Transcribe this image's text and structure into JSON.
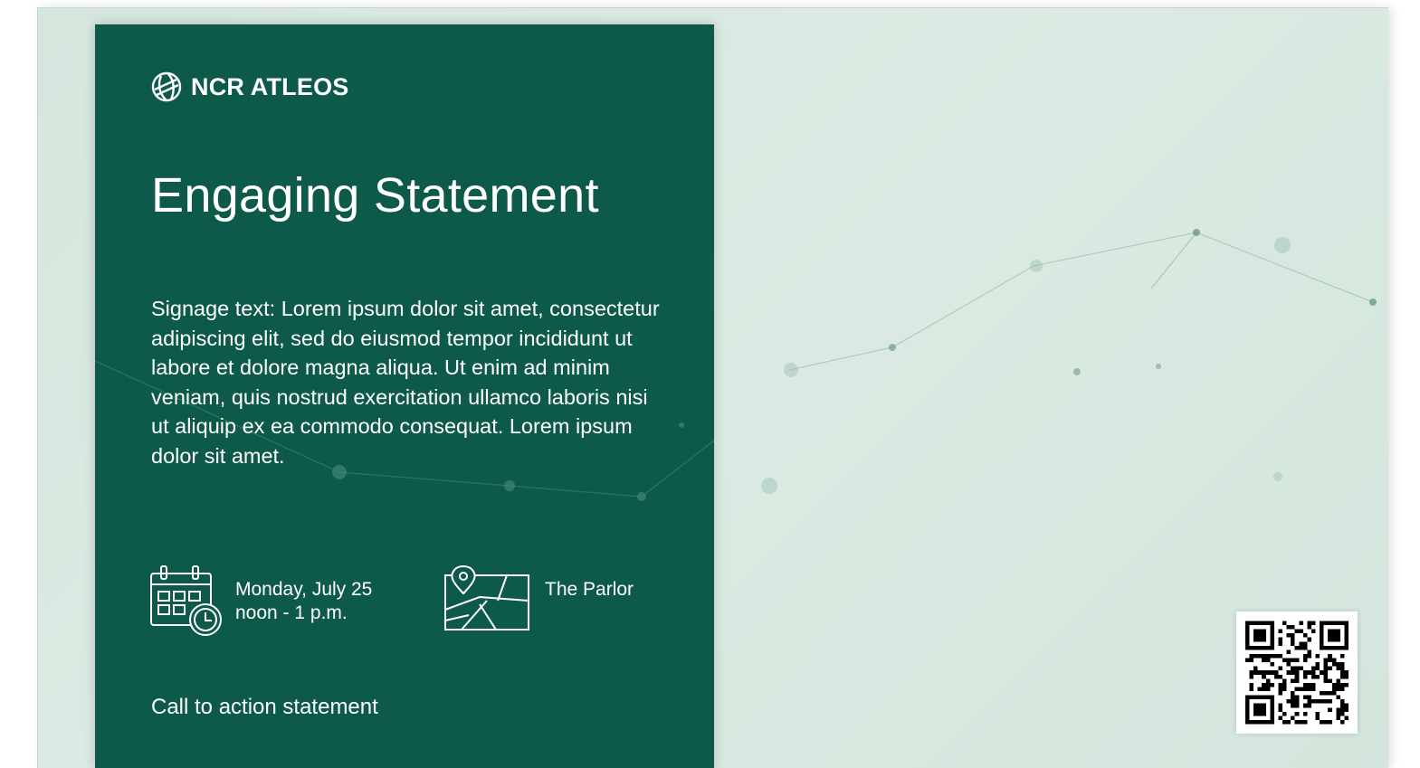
{
  "brand": {
    "name": "NCR ATLEOS",
    "logo_icon": "globe-icon"
  },
  "sign": {
    "headline": "Engaging Statement",
    "body": "Signage text: Lorem ipsum dolor sit amet, consectetur adipiscing elit, sed do eiusmod tempor incididunt ut labore et dolore magna aliqua. Ut enim ad minim veniam, quis nostrud exercitation ullamco laboris nisi ut aliquip ex ea commodo consequat. Lorem ipsum dolor sit amet.",
    "date_line": "Monday, July 25",
    "time_line": "noon - 1 p.m.",
    "place": "The Parlor",
    "cta": "Call to action statement"
  },
  "icons": {
    "calendar": "calendar-clock-icon",
    "map": "map-pin-icon",
    "qr": "qr-code"
  },
  "colors": {
    "panel": "#0e5a4a",
    "background": "#d9e9e1",
    "text": "#ffffff"
  }
}
